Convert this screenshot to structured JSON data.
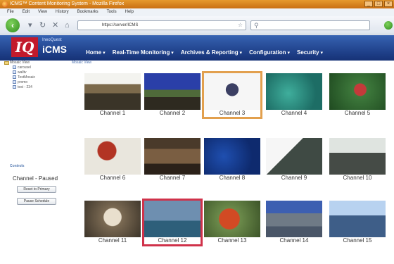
{
  "window": {
    "title": "ICMS™ Content Monitoring System - Mozilla Firefox"
  },
  "menubar": [
    "File",
    "Edit",
    "View",
    "History",
    "Bookmarks",
    "Tools",
    "Help"
  ],
  "nav": {
    "url": "https://server/ICMS"
  },
  "app": {
    "logo_text": "IQ",
    "brand_sub": "IneoQuest",
    "brand_main": "iCMS",
    "topnav": [
      "Home",
      "Real-Time Monitoring",
      "Archives & Reporting",
      "Configuration",
      "Security"
    ]
  },
  "sidebar": {
    "root_label": "Mosaic View",
    "items": [
      "carousel",
      "walltv",
      "TestMosaic",
      "promo",
      "test - 234"
    ],
    "controls_heading": "Controls",
    "channel_status": "Channel - Paused",
    "buttons": [
      "Reset to Primary",
      "Pause Schedule"
    ]
  },
  "main": {
    "title": "Mosaic View",
    "channels": [
      {
        "label": "Channel 1",
        "bg": "linear-gradient(#f3f3ef 0 30%, #7c6a4c 30% 55%, #3a3428 55% 100%)"
      },
      {
        "label": "Channel 2",
        "bg": "linear-gradient(#2a3fa8 0 45%, #4f6a3a 45% 65%, #2e2a20 65%)"
      },
      {
        "label": "Channel 3",
        "bg": "radial-gradient(circle at 50% 45%, #3b3f63 0 18%, #f6f6f6 19%)",
        "selected": "orange"
      },
      {
        "label": "Channel 4",
        "bg": "radial-gradient(circle at 40% 55%, #3fae9c, #1d6d65 70%)"
      },
      {
        "label": "Channel 5",
        "bg": "radial-gradient(circle at 55% 45%, #c43a3a 0 16%, #3e7a3c 18%, #1f4a20)"
      },
      {
        "label": "Channel 6",
        "bg": "radial-gradient(circle at 40% 35%, #b23424 0 22%, #e9e6dd 24%)"
      },
      {
        "label": "Channel 7",
        "bg": "linear-gradient(#4a3a2a 0 30%, #7a5e42 30% 70%, #2b2119 70%)"
      },
      {
        "label": "Channel 8",
        "bg": "radial-gradient(circle at 35% 50%, #1f4fb0, #0e2a6e 70%)"
      },
      {
        "label": "Channel 9",
        "bg": "linear-gradient(135deg, #f6f6f6 0 40%, #3f4a44 40% 100%)"
      },
      {
        "label": "Channel 10",
        "bg": "linear-gradient(#dfe4e0 0 40%, #454b46 40% 100%)"
      },
      {
        "label": "Channel 11",
        "bg": "radial-gradient(circle at 50% 45%, #e9dfcd 0 25%, #7b6a53 27%, #3c3429)"
      },
      {
        "label": "Channel 12",
        "bg": "linear-gradient(#6e8fb0 0 55%, #2e5f7a 55% 100%)",
        "selected": "red"
      },
      {
        "label": "Channel 13",
        "bg": "radial-gradient(circle at 45% 50%, #d24a24 0 28%, #6b8a4a 30%, #3c5428)"
      },
      {
        "label": "Channel 14",
        "bg": "linear-gradient(#3d5fb1 0 35%, #6f7a86 35% 70%, #4a5668 70%)"
      },
      {
        "label": "Channel 15",
        "bg": "linear-gradient(#b8d2f0 0 40%, #3e5e88 40% 100%)"
      }
    ]
  }
}
